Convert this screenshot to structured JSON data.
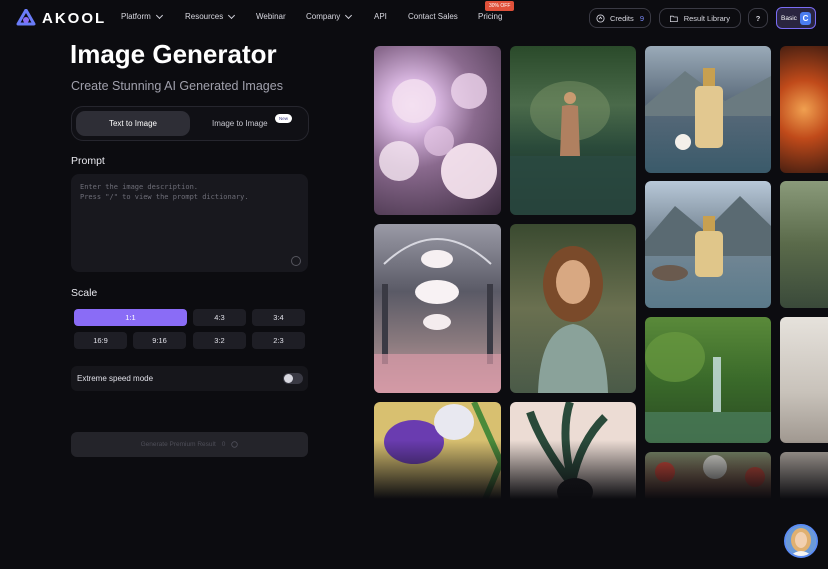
{
  "header": {
    "brand": "AKOOL",
    "nav": [
      {
        "label": "Platform",
        "dropdown": true
      },
      {
        "label": "Resources",
        "dropdown": true
      },
      {
        "label": "Webinar",
        "dropdown": false
      },
      {
        "label": "Company",
        "dropdown": true
      },
      {
        "label": "API",
        "dropdown": false
      },
      {
        "label": "Contact Sales",
        "dropdown": false
      },
      {
        "label": "Pricing",
        "dropdown": false
      }
    ],
    "pricing_badge": "30% OFF",
    "credits_label": "Credits",
    "credits_value": "9",
    "result_library_label": "Result Library",
    "help_label": "?",
    "plan_label": "Basic",
    "plan_initial": "C"
  },
  "generator": {
    "title": "Image Generator",
    "subtitle": "Create Stunning AI Generated Images",
    "tabs": [
      {
        "label": "Text to Image",
        "active": true
      },
      {
        "label": "Image to Image",
        "active": false,
        "badge": "New"
      }
    ],
    "prompt_label": "Prompt",
    "prompt_placeholder": "Enter the image description.\nPress \"/\" to view the prompt dictionary.",
    "scale_label": "Scale",
    "scales": [
      "1:1",
      "4:3",
      "3:4",
      "16:9",
      "9:16",
      "3:2",
      "2:3"
    ],
    "selected_scale": "1:1",
    "speed_mode_label": "Extreme speed mode",
    "speed_mode_enabled": false,
    "generate_label": "Generate Premium Result",
    "generate_cost": "0"
  },
  "gallery": {
    "images": [
      "glowing-flower-field",
      "woman-in-lake",
      "perfume-bottle-lake",
      "fire-swirl",
      "perfume-bottle-mountains",
      "misty-forest",
      "glass-dome-flower-hall",
      "woman-portrait-green-dress",
      "jungle-waterfall",
      "modern-living-room",
      "iris-illustration",
      "plant-and-cat",
      "red-flowers"
    ]
  },
  "colors": {
    "accent": "#8a6cf6",
    "background": "#0c0c10",
    "credits_number": "#7c8cf8",
    "promo": "#e0513a"
  }
}
